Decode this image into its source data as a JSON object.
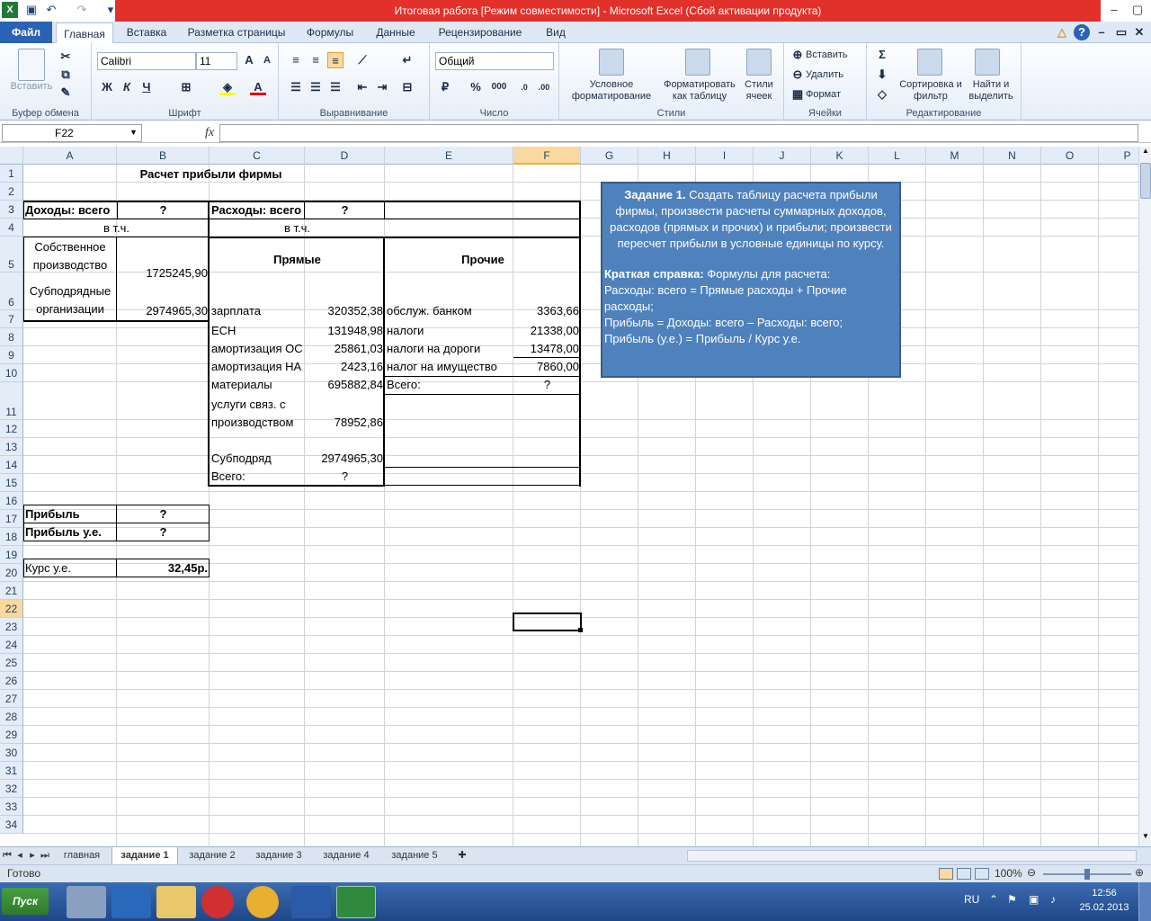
{
  "window": {
    "title": "Итоговая работа  [Режим совместимости]  -  Microsoft Excel (Сбой активации продукта)"
  },
  "ribbon_tabs": [
    "Файл",
    "Главная",
    "Вставка",
    "Разметка страницы",
    "Формулы",
    "Данные",
    "Рецензирование",
    "Вид"
  ],
  "ribbon": {
    "clipboard": {
      "label": "Буфер обмена",
      "paste": "Вставить"
    },
    "font": {
      "label": "Шрифт",
      "name": "Calibri",
      "size": "11",
      "bold": "Ж",
      "italic": "К",
      "underline": "Ч"
    },
    "align": {
      "label": "Выравнивание"
    },
    "number": {
      "label": "Число",
      "format": "Общий",
      "percent": "%",
      "thousands": "000"
    },
    "styles": {
      "label": "Стили",
      "cond": "Условное форматирование",
      "table": "Форматировать как таблицу",
      "cell": "Стили ячеек"
    },
    "cells": {
      "label": "Ячейки",
      "insert": "Вставить",
      "delete": "Удалить",
      "format": "Формат"
    },
    "edit": {
      "label": "Редактирование",
      "sort": "Сортировка и фильтр",
      "find": "Найти и выделить"
    }
  },
  "formula_bar": {
    "name_box": "F22",
    "fx": "fx",
    "value": ""
  },
  "columns": [
    "A",
    "B",
    "C",
    "D",
    "E",
    "F",
    "G",
    "H",
    "I",
    "J",
    "K",
    "L",
    "M",
    "N",
    "O",
    "P"
  ],
  "rows": [
    "1",
    "2",
    "3",
    "4",
    "5",
    "6",
    "7",
    "8",
    "9",
    "10",
    "11",
    "12",
    "13",
    "14",
    "15",
    "16",
    "17",
    "18",
    "19",
    "20",
    "21",
    "22",
    "23",
    "24",
    "25",
    "26",
    "27",
    "28",
    "29",
    "30",
    "31",
    "32",
    "33",
    "34"
  ],
  "cells": {
    "title": "Расчет прибыли фирмы",
    "income_total": "Доходы: всего",
    "income_q": "?",
    "expense_total": "Расходы: всего",
    "expense_q": "?",
    "incl1": "в т.ч.",
    "incl2": "в т.ч.",
    "own_prod": "Собственное производство",
    "own_val": "1725245,90",
    "sub_org": "Субподрядные организации",
    "sub_val": "2974965,30",
    "direct": "Прямые",
    "other": "Прочие",
    "c6": "зарплата",
    "d6": "320352,38",
    "e6": "обслуж. банком",
    "f6": "3363,66",
    "c7": "ЕСН",
    "d7": "131948,98",
    "e7": "налоги",
    "f7": "21338,00",
    "c8": "амортизация ОС",
    "d8": "25861,03",
    "e8": "налоги на дороги",
    "f8": "13478,00",
    "c9": "амортизация НА",
    "d9": "2423,16",
    "e9": "налог на  имущество",
    "f9": "7860,00",
    "c10": "материалы",
    "d10": "695882,84",
    "e10": "Всего:",
    "f10": "?",
    "c11a": "услуги связ. с",
    "c11b": "производством",
    "d11": "78952,86",
    "c13": "Субподряд",
    "d13": "2974965,30",
    "c14": "Всего:",
    "d14": "?",
    "a16": "Прибыль",
    "b16": "?",
    "a17": "Прибыль у.е.",
    "b17": "?",
    "a19": "Курс у.е.",
    "b19": "32,45р."
  },
  "textbox": {
    "task_label": "Задание 1.",
    "task_text": " Создать таблицу расчета прибыли фирмы, произвести расчеты суммарных доходов, расходов (прямых и прочих) и прибыли; произвести пересчет прибыли в условные единицы по курсу.",
    "ref_label": "Краткая справка:",
    "ref_text": " Формулы для расчета:",
    "line1": "Расходы: всего = Прямые расходы + Прочие расходы;",
    "line2": "Прибыль = Доходы: всего – Расходы: всего;",
    "line3": "Прибыль (у.е.) = Прибыль / Курс у.е."
  },
  "sheet_tabs": [
    "главная",
    "задание 1",
    "задание 2",
    "задание 3",
    "задание 4",
    "задание 5"
  ],
  "active_sheet": "задание 1",
  "status": {
    "ready": "Готово",
    "zoom": "100%"
  },
  "taskbar": {
    "start": "Пуск",
    "lang": "RU",
    "time": "12:56",
    "date": "25.02.2013"
  },
  "colors": {
    "title_bar": "#e2302a",
    "file_tab": "#2a63b5",
    "textbox_fill": "#4f81bd",
    "selected_header": "#f9d99f"
  }
}
